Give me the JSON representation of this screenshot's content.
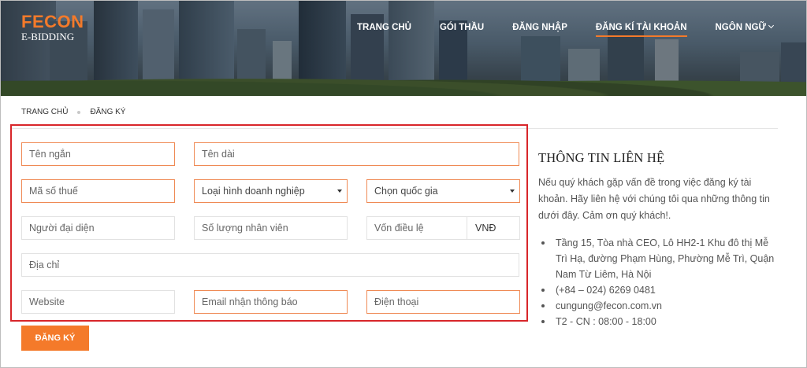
{
  "brand": {
    "name": "FECON",
    "sub": "E-BIDDING"
  },
  "nav": {
    "items": [
      {
        "label": "TRANG CHỦ",
        "active": false
      },
      {
        "label": "GÓI THẦU",
        "active": false
      },
      {
        "label": "ĐĂNG NHẬP",
        "active": false
      },
      {
        "label": "ĐĂNG KÍ TÀI KHOẢN",
        "active": true
      },
      {
        "label": "NGÔN NGỮ",
        "active": false,
        "has_dropdown": true
      }
    ]
  },
  "breadcrumb": {
    "home": "TRANG CHỦ",
    "current": "ĐĂNG KÝ"
  },
  "form": {
    "short_name": {
      "placeholder": "Tên ngắn"
    },
    "long_name": {
      "placeholder": "Tên dài"
    },
    "tax_code": {
      "placeholder": "Mã số thuế"
    },
    "business_type": {
      "selected": "Loại hình doanh nghiệp"
    },
    "country": {
      "selected": "Chọn quốc gia"
    },
    "representative": {
      "placeholder": "Người đại diện"
    },
    "employee_count": {
      "placeholder": "Số lượng nhân viên"
    },
    "capital": {
      "placeholder": "Vốn điều lệ"
    },
    "currency": {
      "selected": "VNĐ"
    },
    "address": {
      "placeholder": "Địa chỉ"
    },
    "website": {
      "placeholder": "Website"
    },
    "notify_email": {
      "placeholder": "Email nhận thông báo"
    },
    "phone": {
      "placeholder": "Điện thoại"
    },
    "submit_label": "ĐĂNG KÝ"
  },
  "contact": {
    "title": "THÔNG TIN LIÊN HỆ",
    "intro": "Nếu quý khách gặp vấn đề trong việc đăng ký tài khoản. Hãy liên hệ với chúng tôi qua những thông tin dưới đây. Cảm ơn quý khách!.",
    "address": "Tầng 15, Tòa nhà CEO, Lô HH2-1 Khu đô thị Mễ Trì Hạ, đường Phạm Hùng, Phường Mễ Trì, Quận Nam Từ Liêm, Hà Nội",
    "phone": "(+84 – 024) 6269 0481",
    "email": "cungung@fecon.com.vn",
    "hours": "T2 - CN : 08:00 - 18:00"
  },
  "colors": {
    "accent": "#f47a2a",
    "highlight_border": "#d8262a",
    "field_highlight": "#ef8a55"
  }
}
